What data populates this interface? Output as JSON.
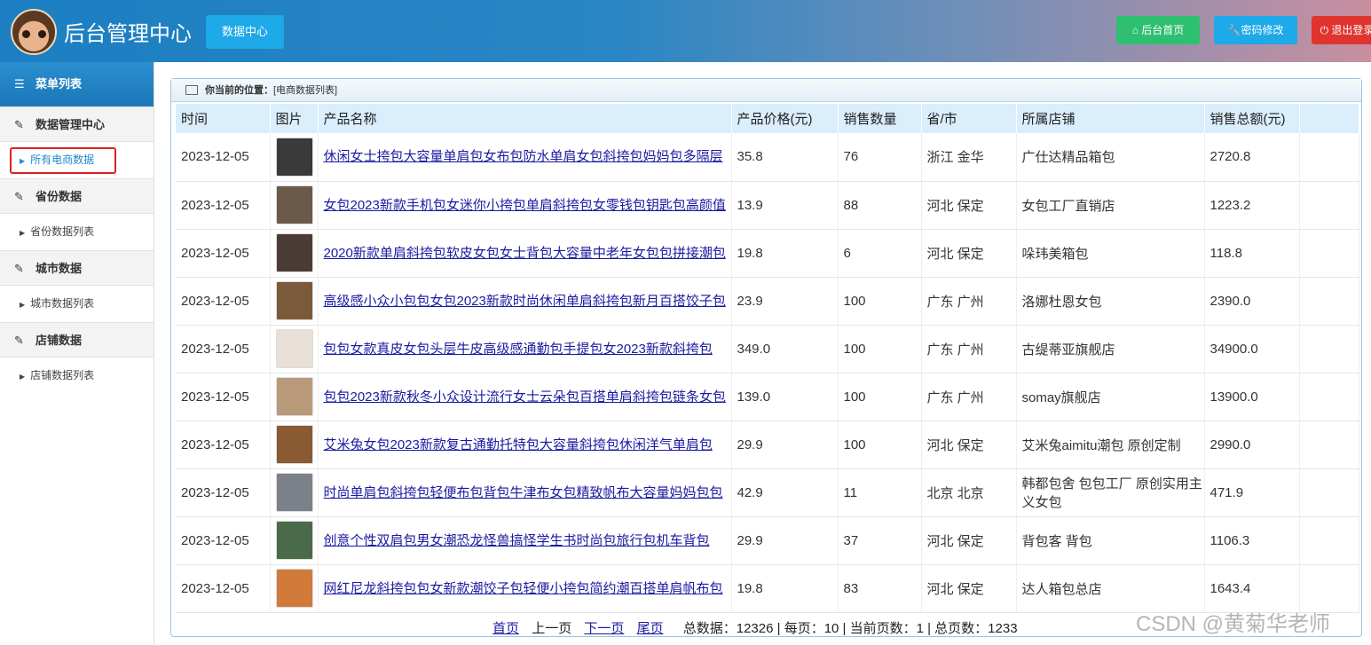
{
  "header": {
    "title": "后台管理中心",
    "data_center": "数据中心",
    "home": "后台首页",
    "password": "密码修改",
    "logout": "退出登录",
    "color_home": "#2fbf71",
    "color_pwd": "#1ea9e8",
    "color_exit": "#e0342f"
  },
  "sidebar": {
    "menu_title": "菜单列表",
    "groups": [
      {
        "label": "数据管理中心",
        "item": "所有电商数据"
      },
      {
        "label": "省份数据",
        "item": "省份数据列表"
      },
      {
        "label": "城市数据",
        "item": "城市数据列表"
      },
      {
        "label": "店铺数据",
        "item": "店铺数据列表"
      }
    ]
  },
  "breadcrumb": {
    "prefix": "你当前的位置：",
    "current": "[电商数据列表]"
  },
  "table": {
    "headers": [
      "时间",
      "图片",
      "产品名称",
      "产品价格(元)",
      "销售数量",
      "省/市",
      "所属店铺",
      "销售总额(元)"
    ],
    "rows": [
      [
        "2023-12-05",
        "#3a3a3a",
        "休闲女士挎包大容量单肩包女布包防水单肩女包斜挎包妈妈包多隔层",
        "35.8",
        "76",
        "浙江 金华",
        "广仕达精品箱包",
        "2720.8"
      ],
      [
        "2023-12-05",
        "#6b5a4a",
        "女包2023新款手机包女迷你小挎包单肩斜挎包女零钱包钥匙包高颜值",
        "13.9",
        "88",
        "河北 保定",
        "女包工厂直销店",
        "1223.2"
      ],
      [
        "2023-12-05",
        "#4a3c34",
        "2020新款单肩斜挎包软皮女包女士背包大容量中老年女包包拼接潮包",
        "19.8",
        "6",
        "河北 保定",
        "哚玮美箱包",
        "118.8"
      ],
      [
        "2023-12-05",
        "#7a5a3a",
        "高级感小众小包包女包2023新款时尚休闲单肩斜挎包新月百搭饺子包",
        "23.9",
        "100",
        "广东 广州",
        "洛娜杜恩女包",
        "2390.0"
      ],
      [
        "2023-12-05",
        "#e8e0d6",
        "包包女款真皮女包头层牛皮高级感通勤包手提包女2023新款斜挎包",
        "349.0",
        "100",
        "广东 广州",
        "古缇蒂亚旗舰店",
        "34900.0"
      ],
      [
        "2023-12-05",
        "#b89a7a",
        "包包2023新款秋冬小众设计流行女士云朵包百搭单肩斜挎包链条女包",
        "139.0",
        "100",
        "广东 广州",
        "somay旗舰店",
        "13900.0"
      ],
      [
        "2023-12-05",
        "#8a5a32",
        "艾米兔女包2023新款复古通勤托特包大容量斜挎包休闲洋气单肩包",
        "29.9",
        "100",
        "河北 保定",
        "艾米兔aimitu潮包 原创定制",
        "2990.0"
      ],
      [
        "2023-12-05",
        "#7c8088",
        "时尚单肩包斜挎包轻便布包背包牛津布女包精致帆布大容量妈妈包包",
        "42.9",
        "11",
        "北京 北京",
        "韩都包舍 包包工厂 原创实用主义女包",
        "471.9"
      ],
      [
        "2023-12-05",
        "#4a6a4a",
        "创意个性双肩包男女潮恐龙怪兽搞怪学生书时尚包旅行包机车背包",
        "29.9",
        "37",
        "河北 保定",
        "背包客 背包",
        "1106.3"
      ],
      [
        "2023-12-05",
        "#d27a3a",
        "网红尼龙斜挎包包女新款潮饺子包轻便小挎包简约潮百搭单肩帆布包",
        "19.8",
        "83",
        "河北 保定",
        "达人箱包总店",
        "1643.4"
      ]
    ]
  },
  "pager": {
    "first": "首页",
    "prev": "上一页",
    "next": "下一页",
    "last": "尾页",
    "summary": "总数据：12326 | 每页：10 | 当前页数：1 | 总页数：1233"
  },
  "watermark": "CSDN @黄菊华老师"
}
